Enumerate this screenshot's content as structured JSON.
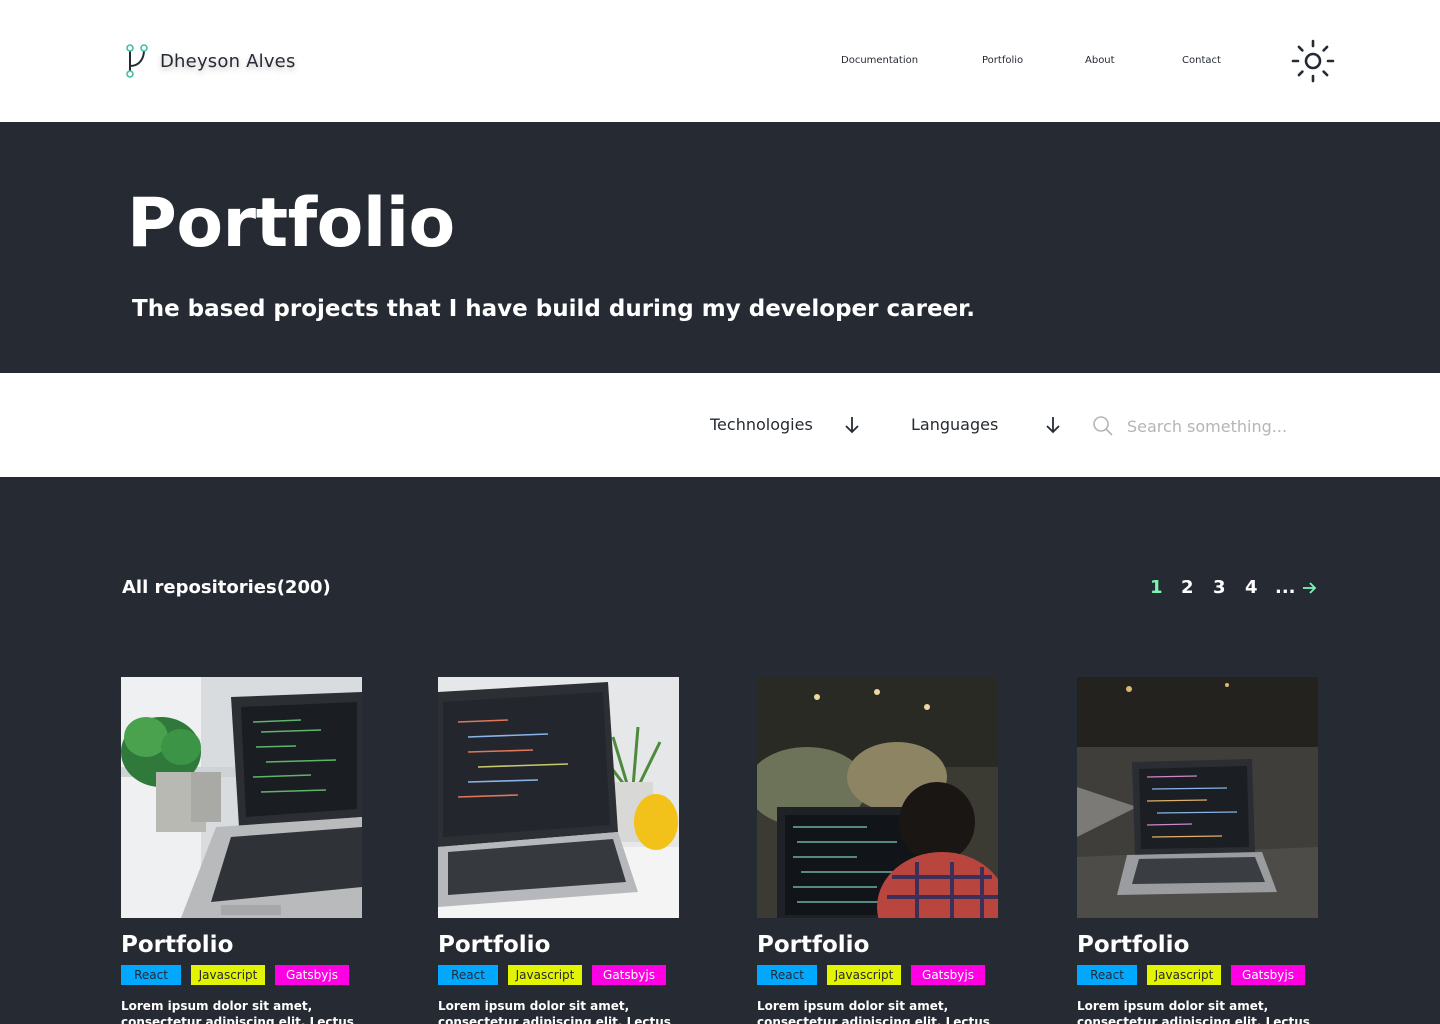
{
  "header": {
    "brand": "Dheyson Alves",
    "nav": [
      "Documentation",
      "Portfolio",
      "About",
      "Contact"
    ]
  },
  "hero": {
    "title": "Portfolio",
    "subtitle": "The based projects that I have build during my developer career."
  },
  "filters": {
    "technologies": "Technologies",
    "languages": "Languages",
    "search_placeholder": "Search something..."
  },
  "repos": {
    "title": "All repositories(200)",
    "pages": [
      "1",
      "2",
      "3",
      "4",
      "..."
    ],
    "current_page": "1"
  },
  "cards": [
    {
      "title": "Portfolio",
      "tags": [
        "React",
        "Javascript",
        "Gatsbyjs"
      ],
      "description": "Lorem ipsum dolor sit amet, consectetur adipiscing elit. Lectus"
    },
    {
      "title": "Portfolio",
      "tags": [
        "React",
        "Javascript",
        "Gatsbyjs"
      ],
      "description": "Lorem ipsum dolor sit amet, consectetur adipiscing elit. Lectus"
    },
    {
      "title": "Portfolio",
      "tags": [
        "React",
        "Javascript",
        "Gatsbyjs"
      ],
      "description": "Lorem ipsum dolor sit amet, consectetur adipiscing elit. Lectus"
    },
    {
      "title": "Portfolio",
      "tags": [
        "React",
        "Javascript",
        "Gatsbyjs"
      ],
      "description": "Lorem ipsum dolor sit amet, consectetur adipiscing elit. Lectus"
    }
  ],
  "colors": {
    "dark": "#262b33",
    "accent": "#7cf4b4",
    "react_tag": "#00a8ff",
    "javascript_tag": "#e3f400",
    "gatsby_tag": "#ff00e5"
  },
  "icons": [
    "brand-logo-icon",
    "sun-icon",
    "arrow-down-icon",
    "search-icon",
    "arrow-right-icon"
  ]
}
